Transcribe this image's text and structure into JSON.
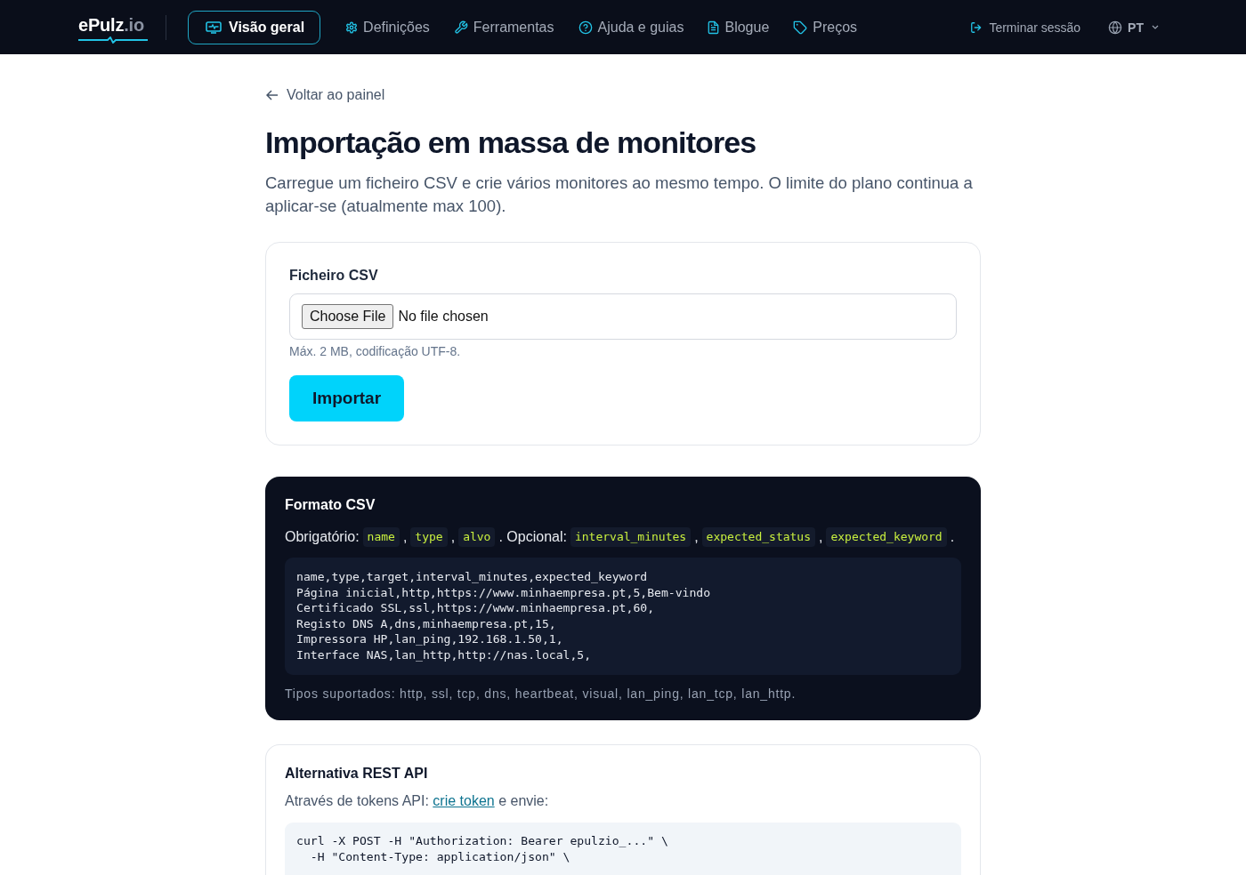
{
  "nav": {
    "logo": {
      "name": "ePulz",
      "suffix": ".io"
    },
    "items": [
      {
        "label": "Visão geral",
        "selected": true
      },
      {
        "label": "Definições",
        "selected": false
      },
      {
        "label": "Ferramentas",
        "selected": false
      },
      {
        "label": "Ajuda e guias",
        "selected": false
      },
      {
        "label": "Blogue",
        "selected": false
      },
      {
        "label": "Preços",
        "selected": false
      }
    ],
    "logout": "Terminar sessão",
    "language": "PT"
  },
  "back_link": "Voltar ao painel",
  "title": "Importação em massa de monitores",
  "description": "Carregue um ficheiro CSV e crie vários monitores ao mesmo tempo. O limite do plano continua a aplicar-se (atualmente max 100).",
  "upload_card": {
    "label": "Ficheiro CSV",
    "file_button": "Choose File",
    "file_status": "No file chosen",
    "hint": "Máx. 2 MB, codificação UTF-8.",
    "submit": "Importar"
  },
  "format_card": {
    "title": "Formato CSV",
    "fields_line": [
      {
        "kind": "text",
        "text": "Obrigatório:"
      },
      {
        "kind": "code",
        "text": "name"
      },
      {
        "kind": "text",
        "text": ","
      },
      {
        "kind": "code",
        "text": "type"
      },
      {
        "kind": "text",
        "text": ","
      },
      {
        "kind": "code",
        "text": "alvo"
      },
      {
        "kind": "text",
        "text": ". Opcional:"
      },
      {
        "kind": "code",
        "text": "interval_minutes"
      },
      {
        "kind": "text",
        "text": ","
      },
      {
        "kind": "code",
        "text": "expected_status"
      },
      {
        "kind": "text",
        "text": ","
      },
      {
        "kind": "code",
        "text": "expected_keyword"
      },
      {
        "kind": "text",
        "text": "."
      }
    ],
    "example_lines": [
      "name,type,target,interval_minutes,expected_keyword",
      "Página inicial,http,https://www.minhaempresa.pt,5,Bem-vindo",
      "Certificado SSL,ssl,https://www.minhaempresa.pt,60,",
      "Registo DNS A,dns,minhaempresa.pt,15,",
      "Impressora HP,lan_ping,192.168.1.50,1,",
      "Interface NAS,lan_http,http://nas.local,5,"
    ],
    "supported_types": "Tipos suportados: http, ssl, tcp, dns, heartbeat, visual, lan_ping, lan_tcp, lan_http."
  },
  "api_card": {
    "title": "Alternativa REST API",
    "intro": "Através de tokens API:",
    "link": "crie token",
    "outro": "e envie:",
    "code_lines": [
      "curl -X POST -H \"Authorization: Bearer epulzio_...\" \\",
      "  -H \"Content-Type: application/json\" \\"
    ]
  }
}
